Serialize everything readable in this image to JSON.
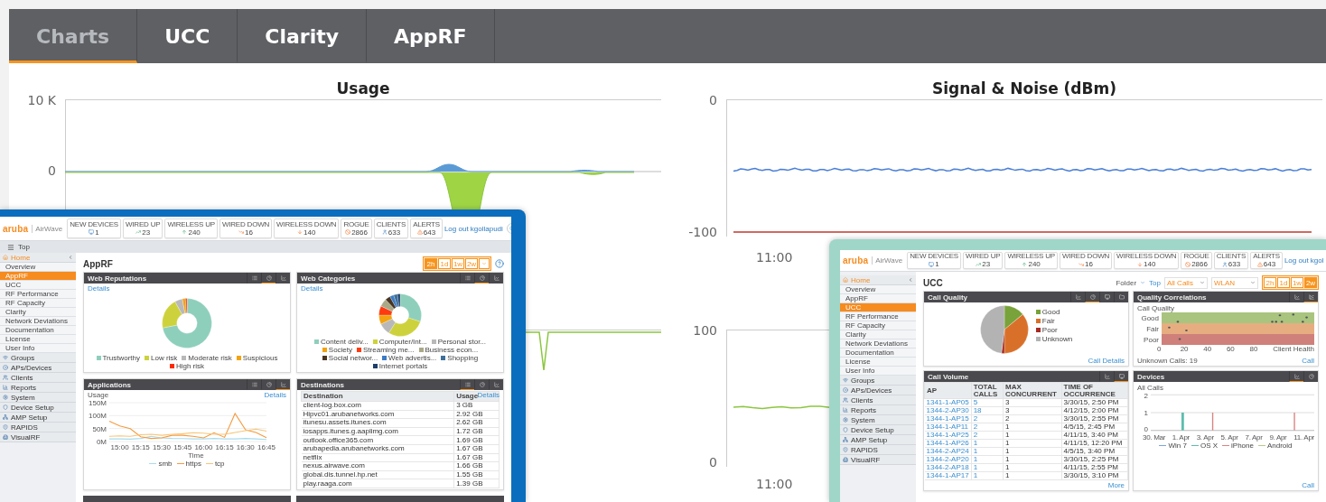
{
  "tabs": [
    {
      "label": "Charts",
      "selected": true
    },
    {
      "label": "UCC",
      "selected": false
    },
    {
      "label": "Clarity",
      "selected": false
    },
    {
      "label": "AppRF",
      "selected": false
    }
  ],
  "charts": [
    {
      "kind": "usage",
      "title": "Usage",
      "y_ticks": [
        "10 K",
        "0"
      ]
    },
    {
      "kind": "signal",
      "title": "Signal & Noise (dBm)",
      "y_ticks": [
        "0",
        "-100"
      ],
      "x_ticks": [
        "11:00"
      ]
    },
    {
      "kind": "spike"
    },
    {
      "kind": "rssi",
      "y_ticks": [
        "100",
        "0"
      ],
      "x_ticks": [
        "11:00"
      ]
    }
  ],
  "apprf_window": {
    "logo": "aruba",
    "product": "AirWave",
    "stats": [
      {
        "kind": "devices",
        "label": "NEW DEVICES",
        "value": "1"
      },
      {
        "kind": "wired_up",
        "label": "WIRED UP",
        "value": "23"
      },
      {
        "kind": "wireless_up",
        "label": "WIRELESS UP",
        "value": "240"
      },
      {
        "kind": "wired_down",
        "label": "WIRED DOWN",
        "value": "16"
      },
      {
        "kind": "wireless_down",
        "label": "WIRELESS DOWN",
        "value": "140"
      },
      {
        "kind": "rogue",
        "label": "ROGUE",
        "value": "2866"
      },
      {
        "kind": "clients",
        "label": "CLIENTS",
        "value": "633"
      },
      {
        "kind": "alerts",
        "label": "ALERTS",
        "value": "643"
      }
    ],
    "logout": "Log out kgollapudi",
    "top_label": "Top",
    "sidebar": [
      {
        "label": "Home",
        "expanded": true,
        "children": [
          {
            "label": "Overview",
            "selected": false
          },
          {
            "label": "AppRF",
            "selected": true
          },
          {
            "label": "UCC",
            "selected": false
          },
          {
            "label": "RF Performance",
            "selected": false
          },
          {
            "label": "RF Capacity",
            "selected": false
          },
          {
            "label": "Clarity",
            "selected": false
          },
          {
            "label": "Network Deviations",
            "selected": false
          },
          {
            "label": "Documentation",
            "selected": false
          },
          {
            "label": "License",
            "selected": false
          },
          {
            "label": "User Info",
            "selected": false
          }
        ]
      },
      {
        "label": "Groups",
        "expanded": false
      },
      {
        "label": "APs/Devices",
        "expanded": false
      },
      {
        "label": "Clients",
        "expanded": false
      },
      {
        "label": "Reports",
        "expanded": false
      },
      {
        "label": "System",
        "expanded": false
      },
      {
        "label": "Device Setup",
        "expanded": false
      },
      {
        "label": "AMP Setup",
        "expanded": false
      },
      {
        "label": "RAPIDS",
        "expanded": false
      },
      {
        "label": "VisualRF",
        "expanded": false
      }
    ],
    "title": "AppRF",
    "time_ranges": [
      {
        "label": "2h",
        "selected": true
      },
      {
        "label": "1d",
        "selected": false
      },
      {
        "label": "1w",
        "selected": false
      },
      {
        "label": "2w",
        "selected": false
      }
    ],
    "panels": [
      {
        "kind": "donut",
        "title": "Web Reputations",
        "link": "Details",
        "views": [
          {
            "kind": "table",
            "selected": false
          },
          {
            "kind": "pie",
            "selected": true
          },
          {
            "kind": "line",
            "selected": false
          }
        ],
        "legend": [
          {
            "label": "Trustworthy",
            "color": "#8ecfbc"
          },
          {
            "label": "Low risk",
            "color": "#cdd23c"
          },
          {
            "label": "Moderate risk",
            "color": "#b8b8b8"
          },
          {
            "label": "Suspicious",
            "color": "#f2a30f"
          },
          {
            "label": "High risk",
            "color": "#ff2a00"
          }
        ]
      },
      {
        "kind": "donut",
        "title": "Web Categories",
        "link": "Details",
        "views": [
          {
            "kind": "table",
            "selected": false
          },
          {
            "kind": "pie",
            "selected": true
          },
          {
            "kind": "line",
            "selected": false
          }
        ],
        "legend": [
          {
            "label": "Content deliv...",
            "color": "#8ecfbc"
          },
          {
            "label": "Computer/Int...",
            "color": "#cdd23c"
          },
          {
            "label": "Personal stor...",
            "color": "#b8b8b8"
          },
          {
            "label": "Society",
            "color": "#f2a30f"
          },
          {
            "label": "Streaming me...",
            "color": "#ff3a10"
          },
          {
            "label": "Business econ...",
            "color": "#a9a987"
          },
          {
            "label": "Social networ...",
            "color": "#4a3522"
          },
          {
            "label": "Web advertis...",
            "color": "#3b7cc4"
          },
          {
            "label": "Shopping",
            "color": "#3e6f99"
          },
          {
            "label": "Internet portals",
            "color": "#1d3d6b"
          }
        ]
      },
      {
        "kind": "line",
        "title": "Applications",
        "link": "Details",
        "views": [
          {
            "kind": "table",
            "selected": false
          },
          {
            "kind": "pie",
            "selected": false
          },
          {
            "kind": "line",
            "selected": true
          }
        ],
        "chart_data": {
          "type": "line",
          "xlabel": "Time",
          "ylabel": "Usage",
          "categories": [
            null,
            "15:00",
            null,
            "15:15",
            null,
            "15:30",
            null,
            "15:45",
            null,
            "16:00",
            null,
            "16:15",
            null,
            "16:30",
            null,
            "16:45"
          ],
          "series": [
            {
              "name": "smb",
              "color": "#a6dcee",
              "values": [
                10,
                10,
                9,
                12,
                20,
                14,
                12,
                11,
                10,
                10,
                12,
                10,
                10,
                12,
                10,
                8
              ]
            },
            {
              "name": "https",
              "color": "#f59a3e",
              "values": [
                78,
                60,
                50,
                18,
                12,
                14,
                24,
                24,
                20,
                14,
                34,
                16,
                108,
                45,
                35,
                15
              ]
            },
            {
              "name": "tcp",
              "color": "#f6c577",
              "values": [
                20,
                22,
                20,
                26,
                28,
                24,
                28,
                30,
                34,
                32,
                28,
                28,
                35,
                42,
                48,
                40
              ]
            }
          ],
          "ylim": [
            0,
            150
          ],
          "yticks": [
            {
              "value": 0,
              "label": "0M"
            },
            {
              "value": 50,
              "label": "50M"
            },
            {
              "value": 100,
              "label": "100M"
            },
            {
              "value": 150,
              "label": "150M"
            }
          ]
        }
      },
      {
        "kind": "table",
        "title": "Destinations",
        "link": "Details",
        "views": [
          {
            "kind": "table",
            "selected": true
          },
          {
            "kind": "pie",
            "selected": false
          },
          {
            "kind": "line",
            "selected": false
          }
        ],
        "columns": [
          "Destination",
          "Usage"
        ],
        "rows": [
          [
            "client-log.box.com",
            "3 GB"
          ],
          [
            "Hipvc01.arubanetworks.com",
            "2.92 GB"
          ],
          [
            "itunesu.assets.itunes.com",
            "2.62 GB"
          ],
          [
            "iosapps.itunes.g.aaplimg.com",
            "1.72 GB"
          ],
          [
            "outlook.office365.com",
            "1.69 GB"
          ],
          [
            "arubapedia.arubanetworks.com",
            "1.67 GB"
          ],
          [
            "netflix",
            "1.67 GB"
          ],
          [
            "nexus.airwave.com",
            "1.66 GB"
          ],
          [
            "global.dis.tunnel.hp.net",
            "1.55 GB"
          ],
          [
            "play.raaga.com",
            "1.39 GB"
          ]
        ]
      }
    ]
  },
  "ucc_window": {
    "logo": "aruba",
    "product": "AirWave",
    "stats": [
      {
        "kind": "devices",
        "label": "NEW DEVICES",
        "value": "1"
      },
      {
        "kind": "wired_up",
        "label": "WIRED UP",
        "value": "23"
      },
      {
        "kind": "wireless_up",
        "label": "WIRELESS UP",
        "value": "240"
      },
      {
        "kind": "wired_down",
        "label": "WIRED DOWN",
        "value": "16"
      },
      {
        "kind": "wireless_down",
        "label": "WIRELESS DOWN",
        "value": "140"
      },
      {
        "kind": "rogue",
        "label": "ROGUE",
        "value": "2866"
      },
      {
        "kind": "clients",
        "label": "CLIENTS",
        "value": "633"
      },
      {
        "kind": "alerts",
        "label": "ALERTS",
        "value": "643"
      }
    ],
    "logout": "Log out kgol",
    "sidebar": [
      {
        "label": "Home",
        "expanded": true,
        "children": [
          {
            "label": "Overview",
            "selected": false
          },
          {
            "label": "AppRF",
            "selected": false
          },
          {
            "label": "UCC",
            "selected": true
          },
          {
            "label": "RF Performance",
            "selected": false
          },
          {
            "label": "RF Capacity",
            "selected": false
          },
          {
            "label": "Clarity",
            "selected": false
          },
          {
            "label": "Network Deviations",
            "selected": false
          },
          {
            "label": "Documentation",
            "selected": false
          },
          {
            "label": "License",
            "selected": false
          },
          {
            "label": "User Info",
            "selected": false
          }
        ]
      },
      {
        "label": "Groups",
        "expanded": false
      },
      {
        "label": "APs/Devices",
        "expanded": false
      },
      {
        "label": "Clients",
        "expanded": false
      },
      {
        "label": "Reports",
        "expanded": false
      },
      {
        "label": "System",
        "expanded": false
      },
      {
        "label": "Device Setup",
        "expanded": false
      },
      {
        "label": "AMP Setup",
        "expanded": false
      },
      {
        "label": "RAPIDS",
        "expanded": false
      },
      {
        "label": "VisualRF",
        "expanded": false
      }
    ],
    "title": "UCC",
    "filters": {
      "folder_label": "Folder",
      "folder_value": "Top",
      "call_type": "All Calls",
      "network": "WLAN"
    },
    "time_ranges": [
      {
        "label": "2h",
        "selected": false
      },
      {
        "label": "1d",
        "selected": false
      },
      {
        "label": "1w",
        "selected": false
      },
      {
        "label": "2w",
        "selected": true
      }
    ],
    "panels": [
      {
        "kind": "pie",
        "title": "Call Quality",
        "link": "Call Details",
        "views": [
          {
            "kind": "line",
            "selected": false
          },
          {
            "kind": "pie",
            "selected": true
          },
          {
            "kind": "device",
            "selected": false
          },
          {
            "kind": "export",
            "selected": false
          }
        ],
        "legend": [
          {
            "label": "Good",
            "color": "#78a23a"
          },
          {
            "label": "Fair",
            "color": "#d9702a"
          },
          {
            "label": "Poor",
            "color": "#a82a25"
          },
          {
            "label": "Unknown",
            "color": "#b3b3b3"
          }
        ]
      },
      {
        "kind": "scatter",
        "title": "Quality Correlations",
        "link": "Call",
        "views": [
          {
            "kind": "line",
            "selected": false
          },
          {
            "kind": "scatter",
            "selected": true
          }
        ],
        "y_label": "Call Quality",
        "bands": [
          {
            "label": "Good",
            "color": "#a9c47e"
          },
          {
            "label": "Fair",
            "color": "#e6ae80"
          },
          {
            "label": "Poor",
            "color": "#cf807b"
          }
        ],
        "x_ticks": [
          "0",
          "20",
          "40",
          "60",
          "80"
        ],
        "x_label": "Client Health",
        "footer": "Unknown Calls: 19"
      },
      {
        "kind": "calls",
        "title": "Call Volume",
        "link": "More",
        "views": [
          {
            "kind": "line",
            "selected": false
          },
          {
            "kind": "device",
            "selected": true
          }
        ],
        "columns": [
          "AP",
          "TOTAL CALLS",
          "MAX CONCURRENT",
          "TIME OF OCCURRENCE"
        ],
        "rows": [
          [
            "1341-1-AP05",
            "5",
            "3",
            "3/30/15, 2:50 PM"
          ],
          [
            "1344-2-AP30",
            "18",
            "3",
            "4/12/15, 2:00 PM"
          ],
          [
            "1344-1-AP15",
            "2",
            "2",
            "3/30/15, 2:55 PM"
          ],
          [
            "1344-1-AP11",
            "2",
            "1",
            "4/5/15, 2:45 PM"
          ],
          [
            "1344-1-AP25",
            "2",
            "1",
            "4/11/15, 3:40 PM"
          ],
          [
            "1344-1-AP26",
            "1",
            "1",
            "4/11/15, 12:20 PM"
          ],
          [
            "1344-2-AP24",
            "1",
            "1",
            "4/5/15, 3:40 PM"
          ],
          [
            "1344-2-AP20",
            "1",
            "1",
            "3/30/15, 2:25 PM"
          ],
          [
            "1344-2-AP18",
            "1",
            "1",
            "4/11/15, 2:55 PM"
          ],
          [
            "1344-1-AP17",
            "1",
            "1",
            "3/30/15, 3:10 PM"
          ]
        ]
      },
      {
        "kind": "bars",
        "title": "Devices",
        "link": "Call",
        "views": [
          {
            "kind": "line",
            "selected": true
          },
          {
            "kind": "pie",
            "selected": false
          }
        ],
        "y_label": "All Calls",
        "y_ticks": [
          "2",
          "1",
          "0"
        ],
        "x_ticks": [
          "30. Mar",
          "1. Apr",
          "3. Apr",
          "5. Apr",
          "7. Apr",
          "9. Apr",
          "11. Apr"
        ],
        "legend": [
          {
            "label": "Win 7",
            "color": "#7ea6d6"
          },
          {
            "label": "OS X",
            "color": "#5dbdae"
          },
          {
            "label": "iPhone",
            "color": "#d98383"
          },
          {
            "label": "Android",
            "color": "#b9c98c"
          }
        ]
      }
    ]
  }
}
